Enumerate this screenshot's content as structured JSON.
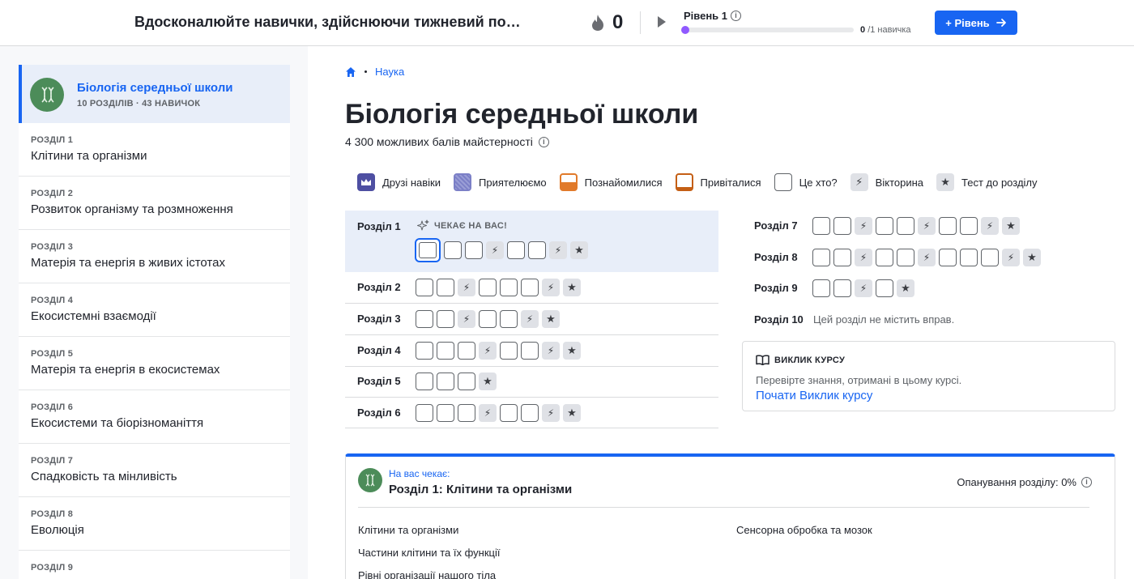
{
  "header": {
    "goal_text": "Вдосконалюйте навички, здійснюючи тижневий по…",
    "streak_count": "0",
    "level_label": "Рівень 1",
    "progress_current": "0",
    "progress_total": "/1 навичка",
    "level_button": "+ Рівень",
    "progress_fraction": 0
  },
  "sidebar": {
    "course_title": "Біологія середньої школи",
    "course_meta": "10 РОЗДІЛІВ · 43 НАВИЧОК",
    "units": [
      {
        "num": "РОЗДІЛ 1",
        "title": "Клітини та організми"
      },
      {
        "num": "РОЗДІЛ 2",
        "title": "Розвиток організму та розмноження"
      },
      {
        "num": "РОЗДІЛ 3",
        "title": "Матерія та енергія в живих істотах"
      },
      {
        "num": "РОЗДІЛ 4",
        "title": "Екосистемні взаємодії"
      },
      {
        "num": "РОЗДІЛ 5",
        "title": "Матерія та енергія в екосистемах"
      },
      {
        "num": "РОЗДІЛ 6",
        "title": "Екосистеми та біорізноманіття"
      },
      {
        "num": "РОЗДІЛ 7",
        "title": "Спадковість та мінливість"
      },
      {
        "num": "РОЗДІЛ 8",
        "title": "Еволюція"
      },
      {
        "num": "РОЗДІЛ 9",
        "title": ""
      }
    ]
  },
  "breadcrumb": {
    "link": "Наука"
  },
  "main": {
    "title": "Біологія середньої школи",
    "mastery_points": "4 300 можливих балів майстерності"
  },
  "legend": [
    {
      "type": "mastered",
      "label": "Друзі навіки"
    },
    {
      "type": "proficient",
      "label": "Приятелюємо"
    },
    {
      "type": "familiar",
      "label": "Познайомилися"
    },
    {
      "type": "attempted",
      "label": "Привіталися"
    },
    {
      "type": "notstarted",
      "label": "Це хто?"
    },
    {
      "type": "quiz",
      "label": "Вікторина"
    },
    {
      "type": "test",
      "label": "Тест до розділу"
    }
  ],
  "units_grid": {
    "waiting_label": "ЧЕКАЄ НА ВАС!",
    "no_exercises": "Цей розділ не містить вправ.",
    "units": [
      {
        "label": "Розділ 1",
        "items": [
          "c",
          "s",
          "s",
          "q",
          "s",
          "s",
          "q",
          "t"
        ]
      },
      {
        "label": "Розділ 2",
        "items": [
          "s",
          "s",
          "q",
          "s",
          "s",
          "s",
          "q",
          "t"
        ]
      },
      {
        "label": "Розділ 3",
        "items": [
          "s",
          "s",
          "q",
          "s",
          "s",
          "q",
          "t"
        ]
      },
      {
        "label": "Розділ 4",
        "items": [
          "s",
          "s",
          "s",
          "q",
          "s",
          "s",
          "q",
          "t"
        ]
      },
      {
        "label": "Розділ 5",
        "items": [
          "s",
          "s",
          "s",
          "t"
        ]
      },
      {
        "label": "Розділ 6",
        "items": [
          "s",
          "s",
          "s",
          "q",
          "s",
          "s",
          "q",
          "t"
        ]
      },
      {
        "label": "Розділ 7",
        "items": [
          "s",
          "s",
          "q",
          "s",
          "s",
          "q",
          "s",
          "s",
          "q",
          "t"
        ]
      },
      {
        "label": "Розділ 8",
        "items": [
          "s",
          "s",
          "q",
          "s",
          "s",
          "q",
          "s",
          "s",
          "s",
          "q",
          "t"
        ]
      },
      {
        "label": "Розділ 9",
        "items": [
          "s",
          "s",
          "q",
          "s",
          "t"
        ]
      },
      {
        "label": "Розділ 10",
        "items": []
      }
    ]
  },
  "challenge": {
    "title": "ВИКЛИК КУРСУ",
    "description": "Перевірте знання, отримані в цьому курсі.",
    "link": "Почати Виклик курсу"
  },
  "up_next": {
    "label": "На вас чекає:",
    "title": "Розділ 1: Клітини та організми",
    "mastery": "Опанування розділу: 0%",
    "lessons_left": [
      "Клітини та організми",
      "Частини клітини та їх функції",
      "Рівні організації нашого тіла"
    ],
    "lessons_right": [
      "Сенсорна обробка та мозок"
    ]
  },
  "colors": {
    "accent": "#1865f2",
    "mastered": "#4e4fa2",
    "familiar": "#e17a2a",
    "attempted": "#c45f15",
    "avatar": "#4c8c59"
  }
}
